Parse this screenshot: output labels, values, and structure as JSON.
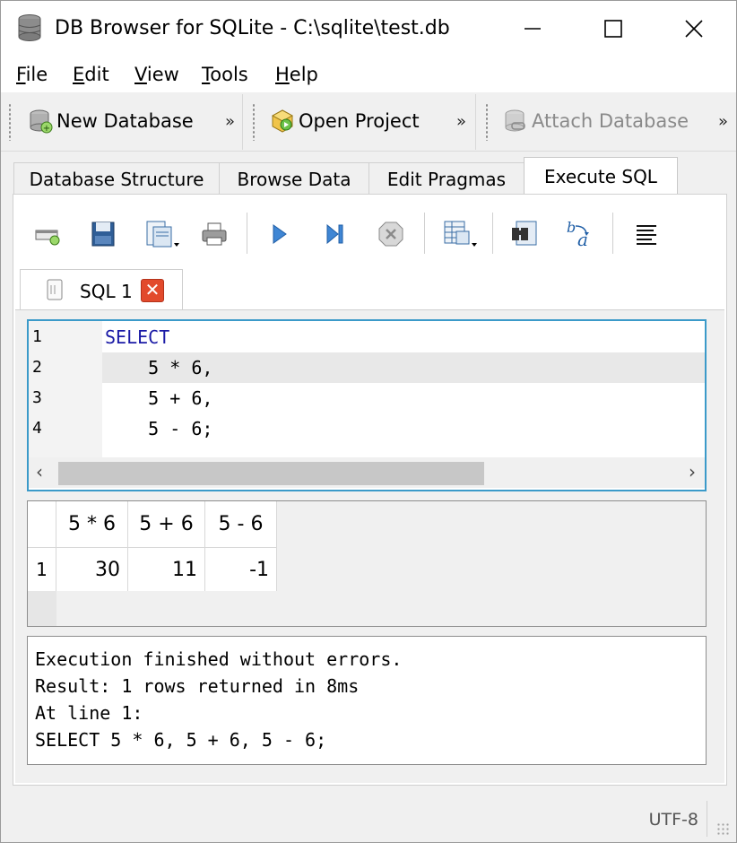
{
  "window": {
    "title": "DB Browser for SQLite - C:\\sqlite\\test.db",
    "minimize_glyph": "—",
    "maximize_glyph": "☐",
    "close_glyph": "✕"
  },
  "menu": {
    "items": [
      {
        "label": "File",
        "mnemonic": "F",
        "rest": "ile"
      },
      {
        "label": "Edit",
        "mnemonic": "E",
        "rest": "dit"
      },
      {
        "label": "View",
        "mnemonic": "V",
        "rest": "iew"
      },
      {
        "label": "Tools",
        "mnemonic": "T",
        "rest": "ools"
      },
      {
        "label": "Help",
        "mnemonic": "H",
        "rest": "elp"
      }
    ]
  },
  "main_toolbar": {
    "new_database": "New Database",
    "open_project": "Open Project",
    "attach_database": "Attach Database",
    "overflow": "»"
  },
  "tabs": [
    {
      "label": "Database Structure",
      "active": false
    },
    {
      "label": "Browse Data",
      "active": false
    },
    {
      "label": "Edit Pragmas",
      "active": false
    },
    {
      "label": "Execute SQL",
      "active": true
    }
  ],
  "sql_toolbar": {
    "icons": [
      "open-tab-icon",
      "open-sql-file-icon",
      "save-sql-file-icon",
      "print-icon",
      "execute-all-icon",
      "execute-line-icon",
      "stop-execution-icon",
      "save-results-icon",
      "find-icon",
      "find-replace-icon",
      "comment-block-icon"
    ]
  },
  "editor_tab": {
    "label": "SQL 1",
    "close": "✕"
  },
  "editor": {
    "lines": [
      {
        "number": "1",
        "text": "SELECT",
        "keyword": true
      },
      {
        "number": "2",
        "text": "    5 * 6,",
        "keyword": false
      },
      {
        "number": "3",
        "text": "    5 + 6,",
        "keyword": false
      },
      {
        "number": "4",
        "text": "    5 - 6;",
        "keyword": false
      }
    ],
    "scroll_left": "‹",
    "scroll_right": "›"
  },
  "results": {
    "columns": [
      "5 * 6",
      "5 + 6",
      "5 - 6"
    ],
    "rows": [
      {
        "row_number": "1",
        "cells": [
          "30",
          "11",
          "-1"
        ]
      }
    ]
  },
  "messages": {
    "lines": [
      "Execution finished without errors.",
      "Result: 1 rows returned in 8ms",
      "At line 1:",
      "SELECT 5 * 6, 5 + 6, 5 - 6;"
    ]
  },
  "status": {
    "encoding": "UTF-8"
  },
  "colors": {
    "editor_focus_border": "#3b9ac9",
    "keyword": "#1a1aa6",
    "close_tab": "#e24a2c"
  }
}
